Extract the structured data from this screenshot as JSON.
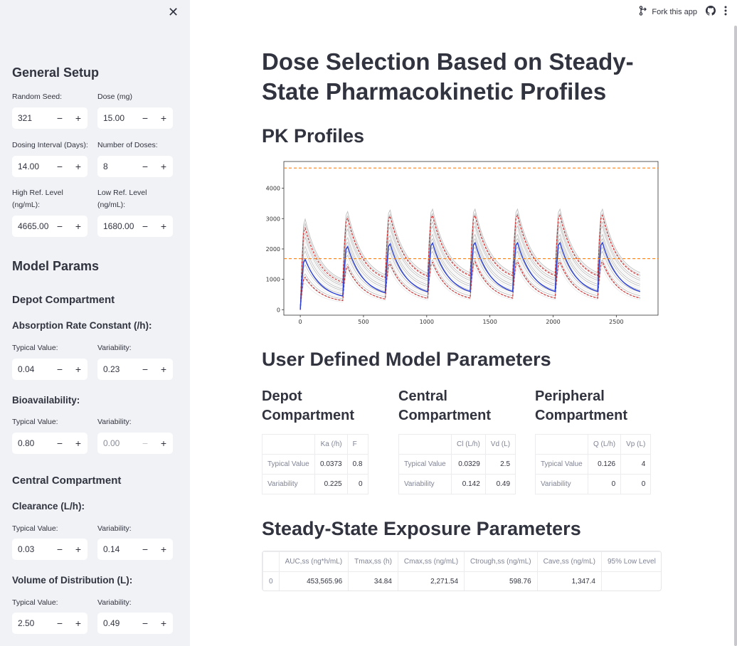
{
  "sidebar": {
    "close_icon": "close-icon",
    "general_setup": "General Setup",
    "random_seed": {
      "label": "Random Seed:",
      "value": "321"
    },
    "dose": {
      "label": "Dose (mg)",
      "value": "15.00"
    },
    "dosing_interval": {
      "label": "Dosing Interval (Days):",
      "value": "14.00"
    },
    "number_of_doses": {
      "label": "Number of Doses:",
      "value": "8"
    },
    "high_ref": {
      "label_line1": "High Ref. Level",
      "label_line2": "(ng/mL):",
      "value": "4665.00"
    },
    "low_ref": {
      "label_line1": "Low Ref. Level",
      "label_line2": "(ng/mL):",
      "value": "1680.00"
    },
    "model_params": "Model Params",
    "depot_compartment": "Depot Compartment",
    "absorption_rate": "Absorption Rate Constant (/h):",
    "ka": {
      "typical_label": "Typical Value:",
      "typical": "0.04",
      "var_label": "Variability:",
      "variability": "0.23"
    },
    "bioavailability": "Bioavailability:",
    "f": {
      "typical_label": "Typical Value:",
      "typical": "0.80",
      "var_label": "Variability:",
      "variability": "0.00"
    },
    "central_compartment": "Central Compartment",
    "clearance": "Clearance (L/h):",
    "cl": {
      "typical_label": "Typical Value:",
      "typical": "0.03",
      "var_label": "Variability:",
      "variability": "0.14"
    },
    "volume": "Volume of Distribution (L):",
    "vd": {
      "typical_label": "Typical Value:",
      "typical": "2.50",
      "var_label": "Variability:",
      "variability": "0.49"
    },
    "minus": "−",
    "plus": "+"
  },
  "topbar": {
    "fork_label": "Fork this app",
    "fork_icon": "fork-icon",
    "github_icon": "github-icon",
    "menu_icon": "kebab-menu-icon"
  },
  "main": {
    "title": "Dose Selection Based on Steady-State Pharmacokinetic Profiles",
    "pk_profiles": "PK Profiles",
    "user_defined": "User Defined Model Parameters",
    "depot": {
      "heading": "Depot Compartment",
      "columns": [
        "",
        "Ka (/h)",
        "F"
      ],
      "rows": [
        [
          "Typical Value",
          "0.0373",
          "0.8"
        ],
        [
          "Variability",
          "0.225",
          "0"
        ]
      ]
    },
    "central": {
      "heading": "Central Compartment",
      "columns": [
        "",
        "Cl (L/h)",
        "Vd (L)"
      ],
      "rows": [
        [
          "Typical Value",
          "0.0329",
          "2.5"
        ],
        [
          "Variability",
          "0.142",
          "0.49"
        ]
      ]
    },
    "peripheral": {
      "heading": "Peripheral Compartment",
      "columns": [
        "",
        "Q (L/h)",
        "Vp (L)"
      ],
      "rows": [
        [
          "Typical Value",
          "0.126",
          "4"
        ],
        [
          "Variability",
          "0",
          "0"
        ]
      ]
    },
    "steady_state": "Steady-State Exposure Parameters",
    "exposure": {
      "columns": [
        "",
        "AUC,ss (ng*h/mL)",
        "Tmax,ss (h)",
        "Cmax,ss (ng/mL)",
        "Ctrough,ss (ng/mL)",
        "Cave,ss (ng/mL)",
        "95% Low Level"
      ],
      "rows": [
        [
          "0",
          "453,565.96",
          "34.84",
          "2,271.54",
          "598.76",
          "1,347.4",
          ""
        ]
      ]
    }
  },
  "chart_data": {
    "type": "line",
    "title": "",
    "xlabel": "",
    "ylabel": "",
    "xlim": [
      -130,
      2830
    ],
    "ylim": [
      -180,
      4880
    ],
    "x_ticks": [
      0,
      500,
      1000,
      1500,
      2000,
      2500
    ],
    "y_ticks": [
      0,
      1000,
      2000,
      3000,
      4000
    ],
    "dose_times": [
      0,
      336,
      672,
      1008,
      1344,
      1680,
      2016,
      2352
    ],
    "end_time": 2688,
    "reference_lines": [
      {
        "value": 4665,
        "color": "#ff7f0e",
        "style": "dashed"
      },
      {
        "value": 1680,
        "color": "#ff7f0e",
        "style": "dashed"
      }
    ],
    "series": [
      {
        "role": "median",
        "color": "#2a3fd6",
        "peaks": [
          1700,
          2130,
          2220,
          2250,
          2260,
          2260,
          2260,
          2260
        ],
        "troughs": [
          450,
          560,
          590,
          600,
          600,
          600,
          600,
          600
        ]
      },
      {
        "role": "upper_percentile",
        "color": "#d62728",
        "style": "dashed",
        "peaks": [
          2750,
          3080,
          3150,
          3170,
          3170,
          3170,
          3170,
          3170
        ],
        "troughs": [
          900,
          1050,
          1100,
          1120,
          1120,
          1120,
          1120,
          1120
        ]
      },
      {
        "role": "lower_percentile",
        "color": "#d62728",
        "style": "dashed",
        "peaks": [
          1100,
          1450,
          1560,
          1600,
          1620,
          1620,
          1620,
          1620
        ],
        "troughs": [
          300,
          350,
          370,
          380,
          380,
          380,
          380,
          380
        ]
      },
      {
        "role": "individual_max",
        "color": "#bfbfbf",
        "peaks": [
          3050,
          3300,
          3350,
          3380,
          3380,
          3380,
          3380,
          3380
        ],
        "troughs": [
          1000,
          1150,
          1200,
          1220,
          1220,
          1220,
          1220,
          1220
        ]
      },
      {
        "role": "individual_min",
        "color": "#bfbfbf",
        "peaks": [
          900,
          1250,
          1350,
          1400,
          1400,
          1400,
          1400,
          1400
        ],
        "troughs": [
          250,
          300,
          320,
          330,
          330,
          330,
          330,
          330
        ]
      }
    ]
  }
}
